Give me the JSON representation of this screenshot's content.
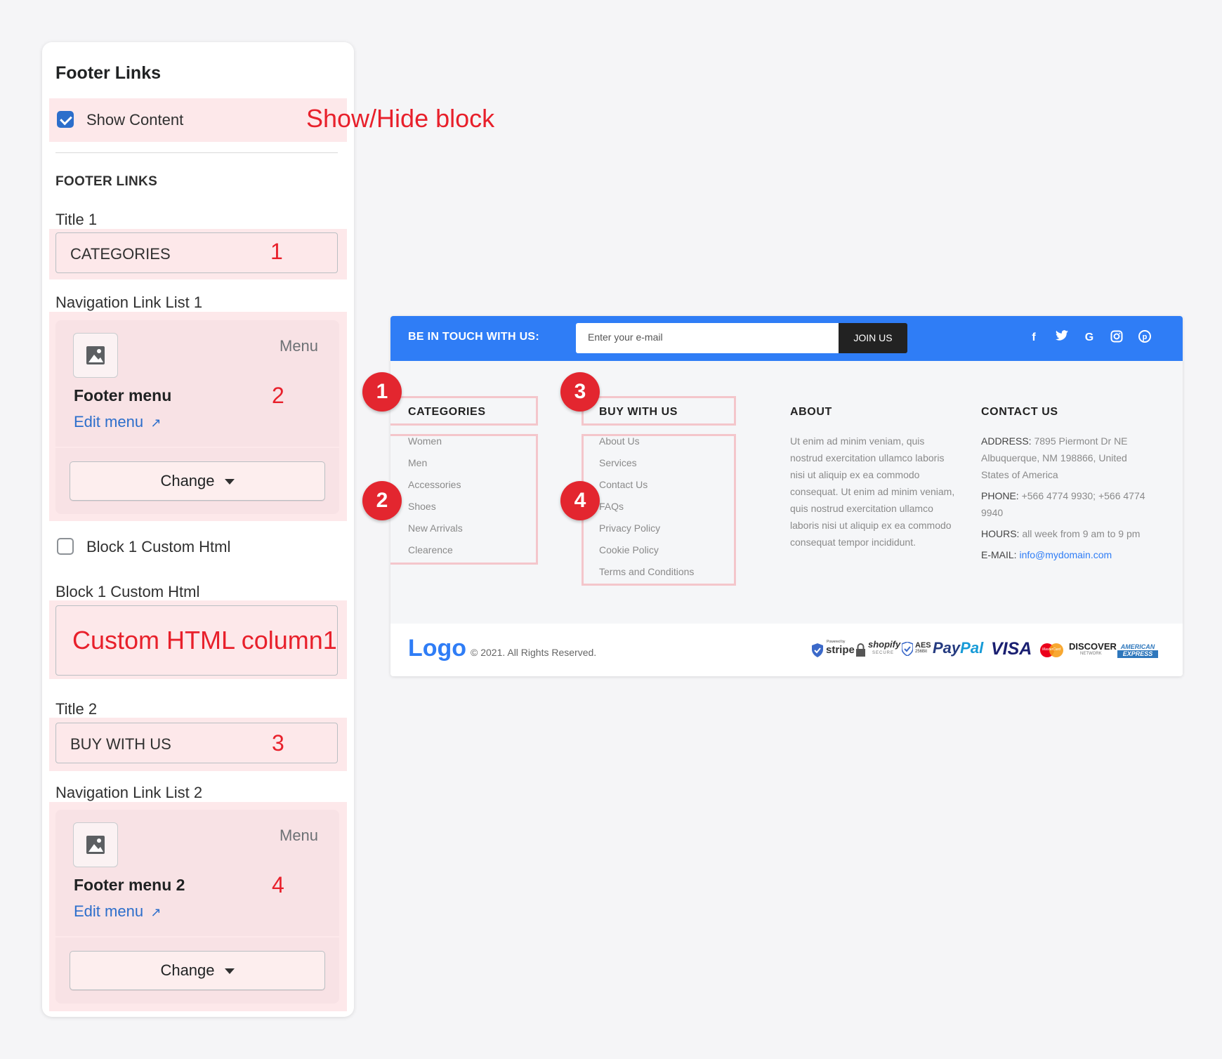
{
  "panel": {
    "title": "Footer Links",
    "show_content": {
      "label": "Show Content",
      "checked": true
    },
    "section_heading": "FOOTER LINKS",
    "title1": {
      "label": "Title 1",
      "value": "CATEGORIES"
    },
    "nav_list1": {
      "label": "Navigation Link List 1",
      "kind": "Menu",
      "menu_name": "Footer menu",
      "edit_label": "Edit menu",
      "change_label": "Change"
    },
    "custom_html_toggle": {
      "label": "Block 1 Custom Html",
      "checked": false
    },
    "custom_html_field": {
      "label": "Block 1 Custom Html",
      "value": "Custom HTML column1"
    },
    "title2": {
      "label": "Title 2",
      "value": "BUY WITH US"
    },
    "nav_list2": {
      "label": "Navigation Link List 2",
      "kind": "Menu",
      "menu_name": "Footer menu 2",
      "edit_label": "Edit menu",
      "change_label": "Change"
    }
  },
  "annotations": {
    "show_hide": "Show/Hide block",
    "n1": "1",
    "n2": "2",
    "n3": "3",
    "n4": "4"
  },
  "footer": {
    "newsletter": {
      "label": "BE IN TOUCH WITH US:",
      "placeholder": "Enter your e-mail",
      "button": "JOIN US",
      "social_icons": [
        "facebook-icon",
        "twitter-icon",
        "google-icon",
        "instagram-icon",
        "pinterest-icon"
      ]
    },
    "columns": {
      "categories": {
        "title": "CATEGORIES",
        "links": [
          "Women",
          "Men",
          "Accessories",
          "Shoes",
          "New Arrivals",
          "Clearence"
        ]
      },
      "buy": {
        "title": "BUY WITH US",
        "links": [
          "About Us",
          "Services",
          "Contact Us",
          "FAQs",
          "Privacy Policy",
          "Cookie Policy",
          "Terms and Conditions"
        ]
      },
      "about": {
        "title": "ABOUT",
        "lines": [
          "Ut enim ad minim veniam, quis",
          "nostrud exercitation ullamco laboris",
          "nisi ut aliquip ex ea commodo",
          "consequat. Ut enim ad minim veniam,",
          "quis nostrud exercitation ullamco",
          "laboris nisi ut aliquip ex ea commodo",
          "consequat tempor incididunt."
        ]
      },
      "contact": {
        "title": "CONTACT US",
        "address_label": "ADDRESS:",
        "address_lines": [
          "7895 Piermont Dr NE",
          "Albuquerque, NM 198866, United",
          "States of America"
        ],
        "phone_label": "PHONE:",
        "phone_lines": [
          "+566 4774 9930; +566 4774",
          "9940"
        ],
        "hours_label": "HOURS:",
        "hours": "all week from 9 am to 9 pm",
        "email_label": "E-MAIL:",
        "email": "info@mydomain.com"
      }
    },
    "logo": "Logo",
    "copyright": "© 2021. All Rights Reserved.",
    "payments": {
      "stripe_small": "Powered by",
      "stripe": "stripe",
      "shopify": "shopify",
      "shopify_sub": "SECURE",
      "aes": "AES",
      "aes_sub": "256Bit",
      "paypal_a": "Pay",
      "paypal_b": "Pal",
      "visa": "VISA",
      "mastercard": "MasterCard",
      "discover": "DISCOVER",
      "discover_sub": "NETWORK",
      "amex_a": "AMERICAN",
      "amex_b": "EXPRESS"
    }
  },
  "colors": {
    "accent": "#2f7df6",
    "annotation": "#e8202b",
    "highlight": "#fde8ea",
    "checkbox": "#2c6ecb"
  }
}
